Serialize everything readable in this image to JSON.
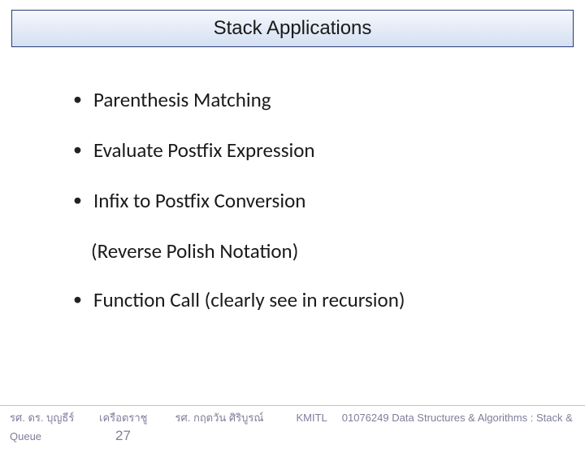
{
  "title": "Stack Applications",
  "bullets": [
    {
      "text": "Parenthesis Matching",
      "sub": false
    },
    {
      "text": "Evaluate Postfix Expression",
      "sub": false
    },
    {
      "text": "Infix to Postfix Conversion",
      "sub": false
    },
    {
      "text": "(Reverse Polish Notation)",
      "sub": true
    },
    {
      "text": "Function Call (clearly see in recursion)",
      "sub": false
    }
  ],
  "footer": {
    "author1": "รศ. ดร. บุญธีร์",
    "author2": "เครือตราชู",
    "author3": "รศ. กฤตวัน   ศิริบูรณ์",
    "institution": "KMITL",
    "course": "01076249 Data Structures & Algorithms : Stack &",
    "queue": "Queue",
    "page": "27"
  }
}
